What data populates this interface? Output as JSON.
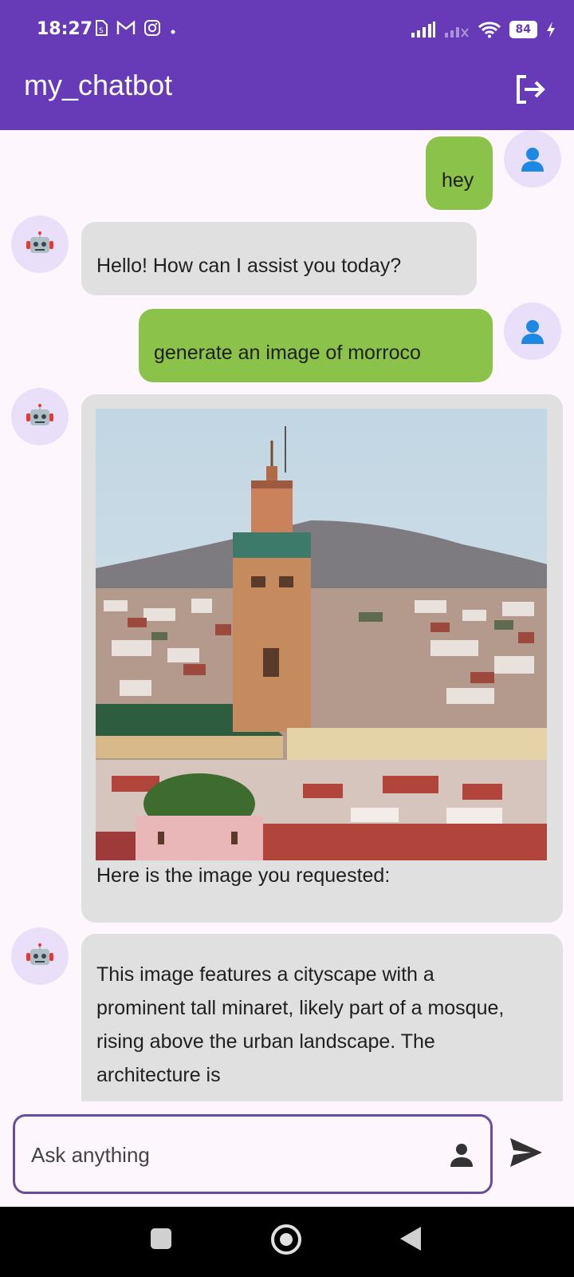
{
  "status": {
    "time": "18:27",
    "icons": [
      "sim-icon",
      "gmail-icon",
      "instagram-icon",
      "dot-icon"
    ],
    "battery": "84"
  },
  "appbar": {
    "title": "my_chatbot",
    "logout_icon": "logout-icon"
  },
  "messages": [
    {
      "role": "user",
      "text": "hey"
    },
    {
      "role": "bot",
      "text": "Hello! How can I assist you today?"
    },
    {
      "role": "user",
      "text": "generate an image of morroco"
    },
    {
      "role": "bot",
      "caption": "Here is the image you requested:",
      "image": "generated-morocco-image"
    },
    {
      "role": "bot",
      "text": "This image features a cityscape with a prominent tall minaret, likely part of a mosque, rising above the urban landscape. The architecture is"
    }
  ],
  "input": {
    "placeholder": "Ask anything",
    "mic_icon": "person-icon",
    "send_icon": "send-icon"
  },
  "colors": {
    "primary": "#673ab7",
    "user_bubble": "#8bc34a",
    "bot_bubble": "#e0e0e0",
    "avatar_bg": "#eadff8"
  }
}
